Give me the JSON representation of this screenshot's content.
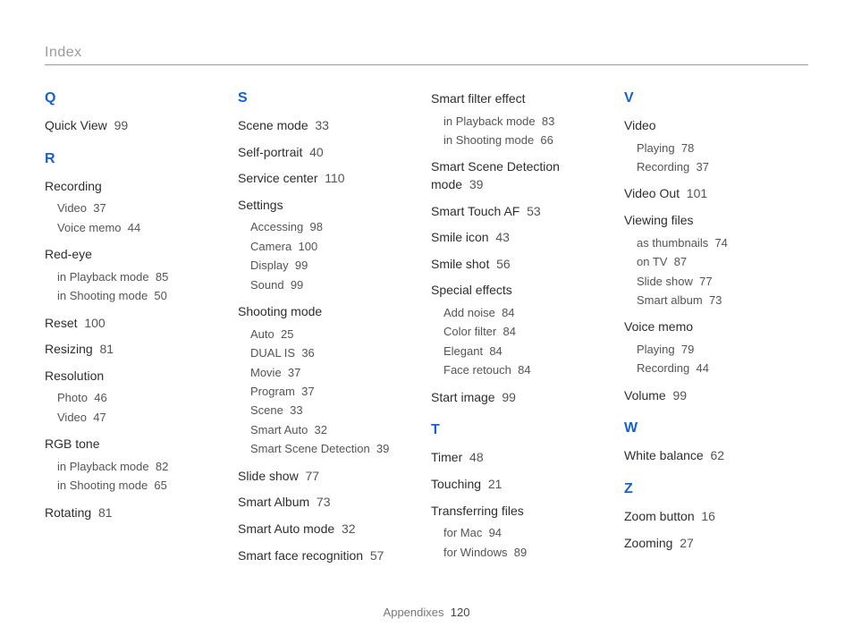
{
  "header": "Index",
  "footer": {
    "section": "Appendixes",
    "page": "120"
  },
  "columns": [
    [
      {
        "type": "letter",
        "text": "Q"
      },
      {
        "type": "entry",
        "label": "Quick View",
        "page": "99"
      },
      {
        "type": "letter",
        "text": "R"
      },
      {
        "type": "entry",
        "label": "Recording",
        "subs": [
          {
            "label": "Video",
            "page": "37"
          },
          {
            "label": "Voice memo",
            "page": "44"
          }
        ]
      },
      {
        "type": "entry",
        "label": "Red-eye",
        "subs": [
          {
            "label": "in Playback mode",
            "page": "85"
          },
          {
            "label": "in Shooting mode",
            "page": "50"
          }
        ]
      },
      {
        "type": "entry",
        "label": "Reset",
        "page": "100"
      },
      {
        "type": "entry",
        "label": "Resizing",
        "page": "81"
      },
      {
        "type": "entry",
        "label": "Resolution",
        "subs": [
          {
            "label": "Photo",
            "page": "46"
          },
          {
            "label": "Video",
            "page": "47"
          }
        ]
      },
      {
        "type": "entry",
        "label": "RGB tone",
        "subs": [
          {
            "label": "in Playback mode",
            "page": "82"
          },
          {
            "label": "in Shooting mode",
            "page": "65"
          }
        ]
      },
      {
        "type": "entry",
        "label": "Rotating",
        "page": "81"
      }
    ],
    [
      {
        "type": "letter",
        "text": "S"
      },
      {
        "type": "entry",
        "label": "Scene mode",
        "page": "33"
      },
      {
        "type": "entry",
        "label": "Self-portrait",
        "page": "40"
      },
      {
        "type": "entry",
        "label": "Service center",
        "page": "110"
      },
      {
        "type": "entry",
        "label": "Settings",
        "subs": [
          {
            "label": "Accessing",
            "page": "98"
          },
          {
            "label": "Camera",
            "page": "100"
          },
          {
            "label": "Display",
            "page": "99"
          },
          {
            "label": "Sound",
            "page": "99"
          }
        ]
      },
      {
        "type": "entry",
        "label": "Shooting mode",
        "subs": [
          {
            "label": "Auto",
            "page": "25"
          },
          {
            "label": "DUAL IS",
            "page": "36"
          },
          {
            "label": "Movie",
            "page": "37"
          },
          {
            "label": "Program",
            "page": "37"
          },
          {
            "label": "Scene",
            "page": "33"
          },
          {
            "label": "Smart Auto",
            "page": "32"
          },
          {
            "label": "Smart Scene Detection",
            "page": "39"
          }
        ]
      },
      {
        "type": "entry",
        "label": "Slide show",
        "page": "77"
      },
      {
        "type": "entry",
        "label": "Smart Album",
        "page": "73"
      },
      {
        "type": "entry",
        "label": "Smart Auto mode",
        "page": "32"
      },
      {
        "type": "entry",
        "label": "Smart face recognition",
        "page": "57"
      }
    ],
    [
      {
        "type": "entry",
        "label": "Smart filter effect",
        "subs": [
          {
            "label": "in Playback mode",
            "page": "83"
          },
          {
            "label": "in Shooting mode",
            "page": "66"
          }
        ]
      },
      {
        "type": "entry",
        "label": "Smart Scene Detection mode",
        "page": "39"
      },
      {
        "type": "entry",
        "label": "Smart Touch AF",
        "page": "53"
      },
      {
        "type": "entry",
        "label": "Smile icon",
        "page": "43"
      },
      {
        "type": "entry",
        "label": "Smile shot",
        "page": "56"
      },
      {
        "type": "entry",
        "label": "Special effects",
        "subs": [
          {
            "label": "Add noise",
            "page": "84"
          },
          {
            "label": "Color filter",
            "page": "84"
          },
          {
            "label": "Elegant",
            "page": "84"
          },
          {
            "label": "Face retouch",
            "page": "84"
          }
        ]
      },
      {
        "type": "entry",
        "label": "Start image",
        "page": "99"
      },
      {
        "type": "letter",
        "text": "T"
      },
      {
        "type": "entry",
        "label": "Timer",
        "page": "48"
      },
      {
        "type": "entry",
        "label": "Touching",
        "page": "21"
      },
      {
        "type": "entry",
        "label": "Transferring files",
        "subs": [
          {
            "label": "for Mac",
            "page": "94"
          },
          {
            "label": "for Windows",
            "page": "89"
          }
        ]
      }
    ],
    [
      {
        "type": "letter",
        "text": "V"
      },
      {
        "type": "entry",
        "label": "Video",
        "subs": [
          {
            "label": "Playing",
            "page": "78"
          },
          {
            "label": "Recording",
            "page": "37"
          }
        ]
      },
      {
        "type": "entry",
        "label": "Video Out",
        "page": "101"
      },
      {
        "type": "entry",
        "label": "Viewing files",
        "subs": [
          {
            "label": "as thumbnails",
            "page": "74"
          },
          {
            "label": "on TV",
            "page": "87"
          },
          {
            "label": "Slide show",
            "page": "77"
          },
          {
            "label": "Smart album",
            "page": "73"
          }
        ]
      },
      {
        "type": "entry",
        "label": "Voice memo",
        "subs": [
          {
            "label": "Playing",
            "page": "79"
          },
          {
            "label": "Recording",
            "page": "44"
          }
        ]
      },
      {
        "type": "entry",
        "label": "Volume",
        "page": "99"
      },
      {
        "type": "letter",
        "text": "W"
      },
      {
        "type": "entry",
        "label": "White balance",
        "page": "62"
      },
      {
        "type": "letter",
        "text": "Z"
      },
      {
        "type": "entry",
        "label": "Zoom button",
        "page": "16"
      },
      {
        "type": "entry",
        "label": "Zooming",
        "page": "27"
      }
    ]
  ]
}
